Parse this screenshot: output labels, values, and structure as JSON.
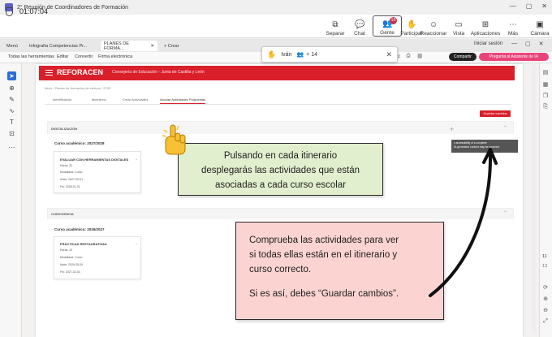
{
  "window": {
    "title": "2° Reunión de Coordinadores de Formación"
  },
  "meeting": {
    "timer": "01:07:04",
    "tools": [
      {
        "label": "Separar",
        "icon": "⧉"
      },
      {
        "label": "Chat",
        "icon": "💬"
      },
      {
        "label": "Gente",
        "icon": "👥",
        "badge": "15"
      },
      {
        "label": "Participar",
        "icon": "✋"
      },
      {
        "label": "Reaccionar",
        "icon": "☺"
      },
      {
        "label": "Vista",
        "icon": "▭"
      },
      {
        "label": "Aplicaciones",
        "icon": "⊞"
      },
      {
        "label": "Más",
        "icon": "⋯"
      },
      {
        "label": "Cámara",
        "icon": "▣"
      }
    ]
  },
  "browser": {
    "tabs": [
      "Menú",
      "Infografía Competencias Pr...",
      "PLANES DE FORMA...",
      "Crear"
    ],
    "signin": "Iniciar sesión"
  },
  "apptoolbar": {
    "menu": [
      "Todas las herramientas",
      "Editar",
      "Convertir",
      "Firma electrónica"
    ],
    "share": "Compartir",
    "ask": "Pregunta al Asistente de IA"
  },
  "popup": {
    "name": "Iván",
    "more": "+ 14"
  },
  "document": {
    "brand": "REFORACEN",
    "brand_sub": "Consejería de Educación - Junta de Castilla y León",
    "breadcrumb": "Inicio / Planes de formación de centros / 5793",
    "tabs": [
      "Identificación",
      "Itinerarios",
      "Crear Actividades",
      "Asociar Actividades Propuestas"
    ],
    "save_button": "Guardar cambios",
    "tooltip_line1": "x accessibility of a complete",
    "tooltip_line2": "AI-generated content may be incorrect",
    "sections": [
      {
        "heading": "DIGITALIZACIÓN",
        "year": "Curso académico: 2027/2028",
        "card": {
          "title": "EVALUAR CON HERRAMIENTAS DIGITALES",
          "lines": [
            "Horas: 20",
            "Modalidad: Curso",
            "Inicio: 2027-09-01",
            "Fin: 2028-01-31"
          ]
        }
      },
      {
        "heading": "CONVIVENCIA",
        "year": "Curso académico: 2026/2027",
        "card": {
          "title": "PRÁCTICAS RESTAURATIVAS",
          "lines": [
            "Horas: 20",
            "Modalidad: Curso",
            "Inicio: 2026-09-09",
            "Fin: 2027-02-04"
          ]
        }
      }
    ]
  },
  "annotations": {
    "note1": [
      "Pulsando en cada itinerario",
      "desplegarás las actividades que están",
      "asociadas a cada curso escolar"
    ],
    "note2": [
      "Comprueba las actividades para ver",
      "si todas ellas están en el itinerario y",
      "curso correcto.",
      "Si es así, debes “Guardar cambios”."
    ]
  },
  "pages": {
    "current": "11",
    "total": "13"
  },
  "colors": {
    "brand_red": "#d9202a",
    "note_green": "#e2efcf",
    "note_pink": "#fbd4d2",
    "teams_accent": "#5b5fc7"
  }
}
